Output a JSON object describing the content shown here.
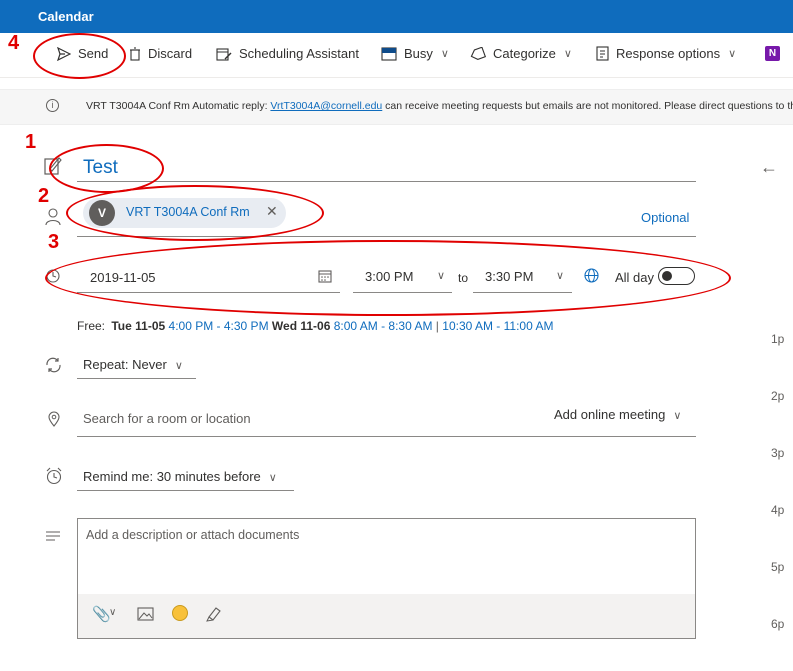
{
  "app": {
    "title": "Calendar"
  },
  "toolbar": {
    "send": "Send",
    "discard": "Discard",
    "scheduling": "Scheduling Assistant",
    "busy": "Busy",
    "categorize": "Categorize",
    "response": "Response options"
  },
  "banner": {
    "prefix": "VRT T3004A Conf Rm Automatic reply: ",
    "link": "VrtT3004A@cornell.edu",
    "suffix": " can receive meeting requests but emails are not monitored. Please direct questions to the room owner."
  },
  "event": {
    "title": "Test",
    "attendee_initial": "V",
    "attendee_name": "VRT T3004A Conf Rm",
    "optional_label": "Optional",
    "date": "2019-11-05",
    "start_time": "3:00 PM",
    "to_label": "to",
    "end_time": "3:30 PM",
    "all_day_label": "All day"
  },
  "free": {
    "label": "Free:",
    "day1": "Tue 11-05",
    "slot1": "4:00 PM - 4:30 PM",
    "day2": "Wed 11-06",
    "slot2": "8:00 AM - 8:30 AM",
    "separator": "|",
    "slot3": "10:30 AM - 11:00 AM"
  },
  "repeat": {
    "label": "Repeat: Never"
  },
  "location": {
    "placeholder": "Search for a room or location",
    "online_meeting": "Add online meeting"
  },
  "reminder": {
    "label": "Remind me: 30 minutes before"
  },
  "description": {
    "placeholder": "Add a description or attach documents"
  },
  "timeline": {
    "hours": [
      "1p",
      "2p",
      "3p",
      "4p",
      "5p",
      "6p"
    ]
  },
  "annotations": {
    "n1": "1",
    "n2": "2",
    "n3": "3",
    "n4": "4"
  },
  "colors": {
    "accent": "#0f6cbd",
    "annotation": "#e00000",
    "onenote": "#7719aa"
  }
}
